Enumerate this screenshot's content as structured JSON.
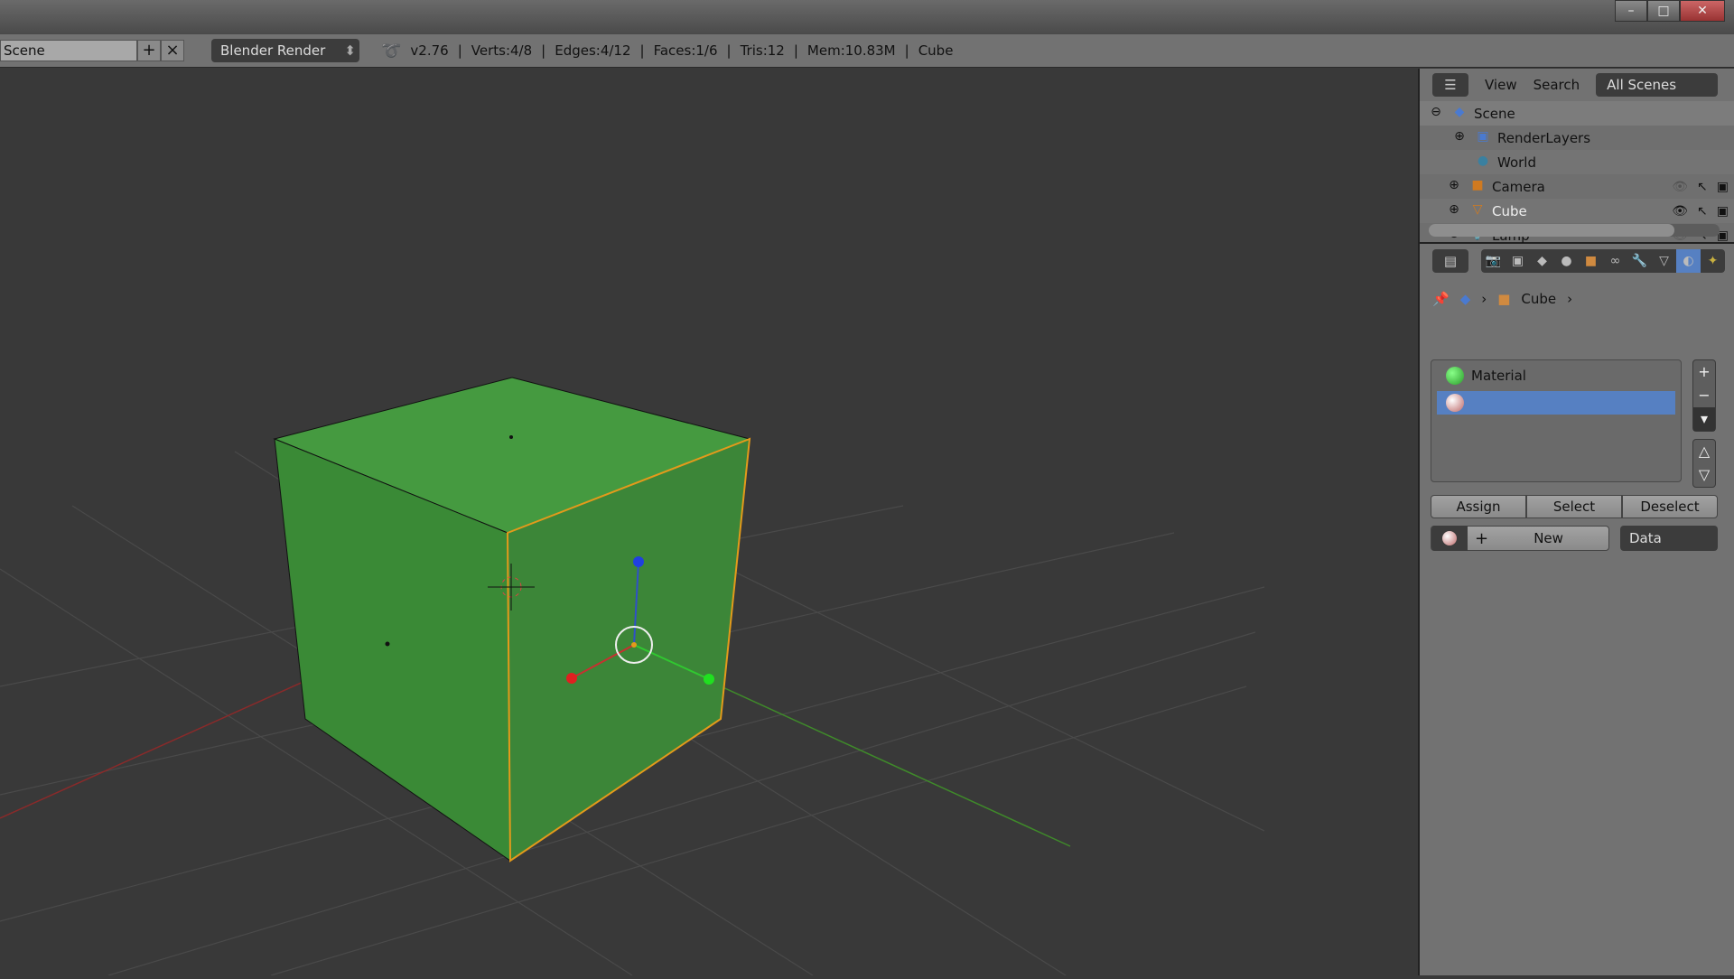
{
  "header": {
    "scene": "Scene",
    "engine": "Blender Render",
    "version": "v2.76",
    "verts": "Verts:4/8",
    "edges": "Edges:4/12",
    "faces": "Faces:1/6",
    "tris": "Tris:12",
    "mem": "Mem:10.83M",
    "object": "Cube"
  },
  "window": {
    "minimize": "–",
    "maximize": "□",
    "close": "✕"
  },
  "outliner": {
    "view": "View",
    "search": "Search",
    "filter": "All Scenes",
    "items": [
      {
        "label": "Scene",
        "icon": "scene-icon"
      },
      {
        "label": "RenderLayers",
        "icon": "renderlayers-icon"
      },
      {
        "label": "World",
        "icon": "world-icon"
      },
      {
        "label": "Camera",
        "icon": "camera-icon"
      },
      {
        "label": "Cube",
        "icon": "mesh-icon",
        "visible": true
      },
      {
        "label": "Lamp",
        "icon": "lamp-icon"
      }
    ]
  },
  "properties": {
    "breadcrumb": "Cube",
    "active_tab": "material",
    "slots": [
      {
        "label": "Material",
        "color": "#2e9e2e"
      },
      {
        "label": "",
        "selected": true
      }
    ],
    "assign": "Assign",
    "select": "Select",
    "deselect": "Deselect",
    "new": "New",
    "link": "Data"
  },
  "colors": {
    "cube": "#3e8a3a",
    "selection": "#5680c2",
    "edge": "#e39a1b"
  }
}
